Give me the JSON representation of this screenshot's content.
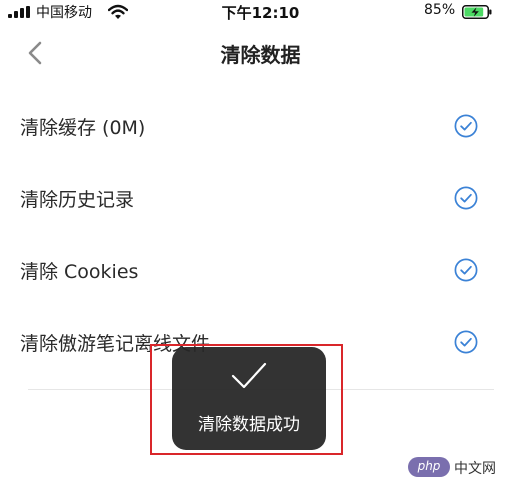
{
  "status_bar": {
    "carrier": "中国移动",
    "time": "下午12:10",
    "battery_percent": "85%",
    "battery_level": 0.85,
    "battery_color": "#4cd964"
  },
  "nav": {
    "back_icon": "chevron-left-icon",
    "title": "清除数据"
  },
  "items": [
    {
      "label": "清除缓存 (0M)",
      "checked": true
    },
    {
      "label": "清除历史记录",
      "checked": true
    },
    {
      "label": "清除 Cookies",
      "checked": true
    },
    {
      "label": "清除傲游笔记离线文件",
      "checked": true
    }
  ],
  "check_color": "#3b82d6",
  "toast": {
    "icon": "checkmark-icon",
    "message": "清除数据成功"
  },
  "highlight_color": "#d9262a",
  "watermark": {
    "badge": "php",
    "site": "中文网"
  }
}
